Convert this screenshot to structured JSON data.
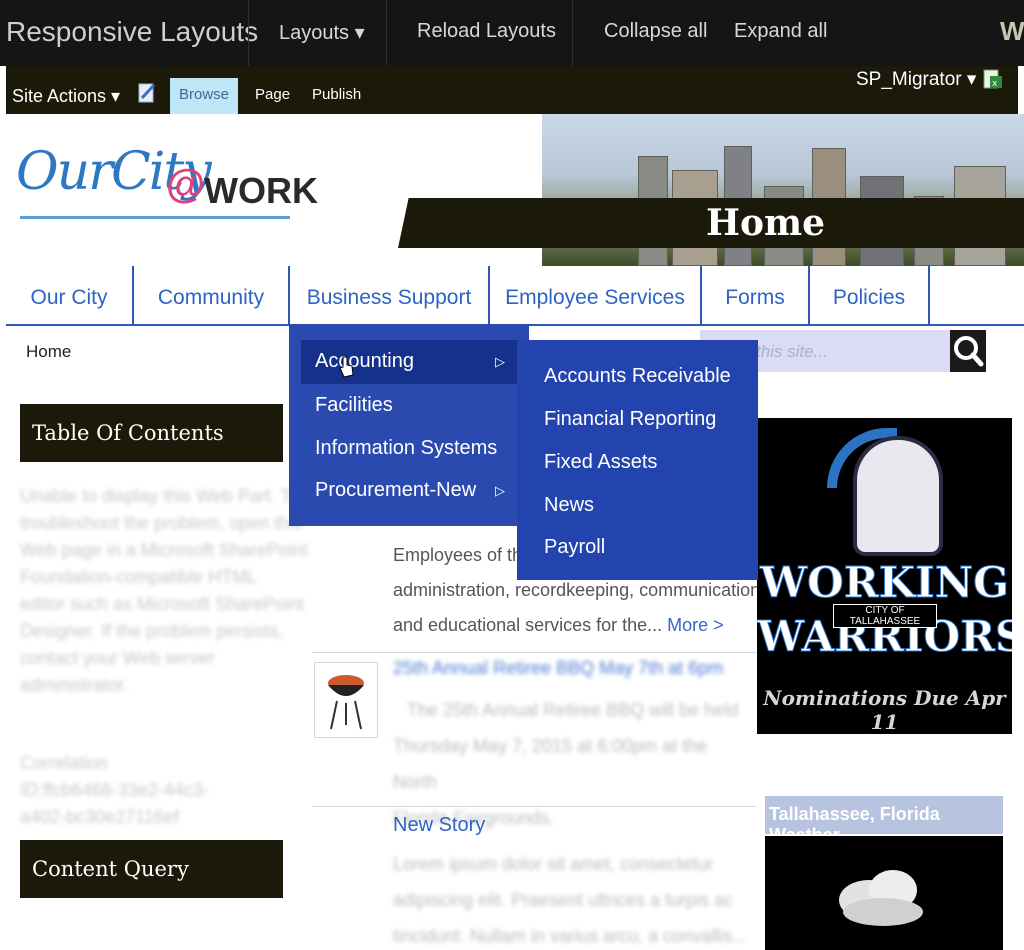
{
  "topbar": {
    "title": "Responsive Layouts",
    "layouts": "Layouts ▾",
    "reload": "Reload Layouts",
    "collapse": "Collapse all",
    "expand": "Expand all",
    "logo": "W"
  },
  "ribbon": {
    "site_actions": "Site Actions ▾",
    "tabs": [
      "Browse",
      "Page",
      "Publish"
    ],
    "user": "SP_Migrator ▾"
  },
  "header": {
    "logo_our_city": "OurCity",
    "logo_at": "@",
    "logo_work": "WORK",
    "home_title": "Home"
  },
  "nav": {
    "items": [
      "Our City",
      "Community",
      "Business Support",
      "Employee Services",
      "Forms",
      "Policies"
    ]
  },
  "breadcrumb": "Home",
  "search": {
    "placeholder": "this site..."
  },
  "dropdown": {
    "level1": [
      "Accounting",
      "Facilities",
      "Information Systems",
      "Procurement-New"
    ],
    "level2": [
      "Accounts Receivable",
      "Financial Reporting",
      "Fixed Assets",
      "News",
      "Payroll"
    ]
  },
  "left": {
    "toc_title": "Table Of Contents",
    "toc_text": [
      "Unable to display this Web Part. To",
      "troubleshoot the problem, open this",
      "Web page in a Microsoft SharePoint",
      "Foundation-compatible HTML",
      "editor such as Microsoft SharePoint",
      "Designer. If the problem persists,",
      "contact your Web server",
      "administrator."
    ],
    "correlation": [
      "Correlation",
      "ID:ffcb6466-33e2-44c3-",
      "a402-bc30e27116ef"
    ],
    "cq_title": "Content Query"
  },
  "center": {
    "intro_lines": [
      "Employees of th",
      "administration, recordkeeping, communication",
      "and educational services for the..."
    ],
    "more": "More >",
    "bbq_title": "25th Annual Retiree BBQ May 7th at 6pm",
    "bbq_text": [
      "The 25th Annual Retiree BBQ will be held",
      "Thursday May 7, 2015 at 6:00pm at the North",
      "Florida Fairgrounds."
    ],
    "story_title": "New Story",
    "story_text": [
      "Lorem ipsum dolor sit amet, consectetur",
      "adipiscing elit. Praesent ultrices a turpis ac",
      "tincidunt. Nullam in varius arcu, a convallis..."
    ]
  },
  "right": {
    "warriors_1": "WORKING",
    "warriors_city": "CITY OF TALLAHASSEE",
    "warriors_2": "WARRIORS",
    "nominations": "Nominations Due Apr 11",
    "weather_title": "Tallahassee, Florida Weather"
  }
}
